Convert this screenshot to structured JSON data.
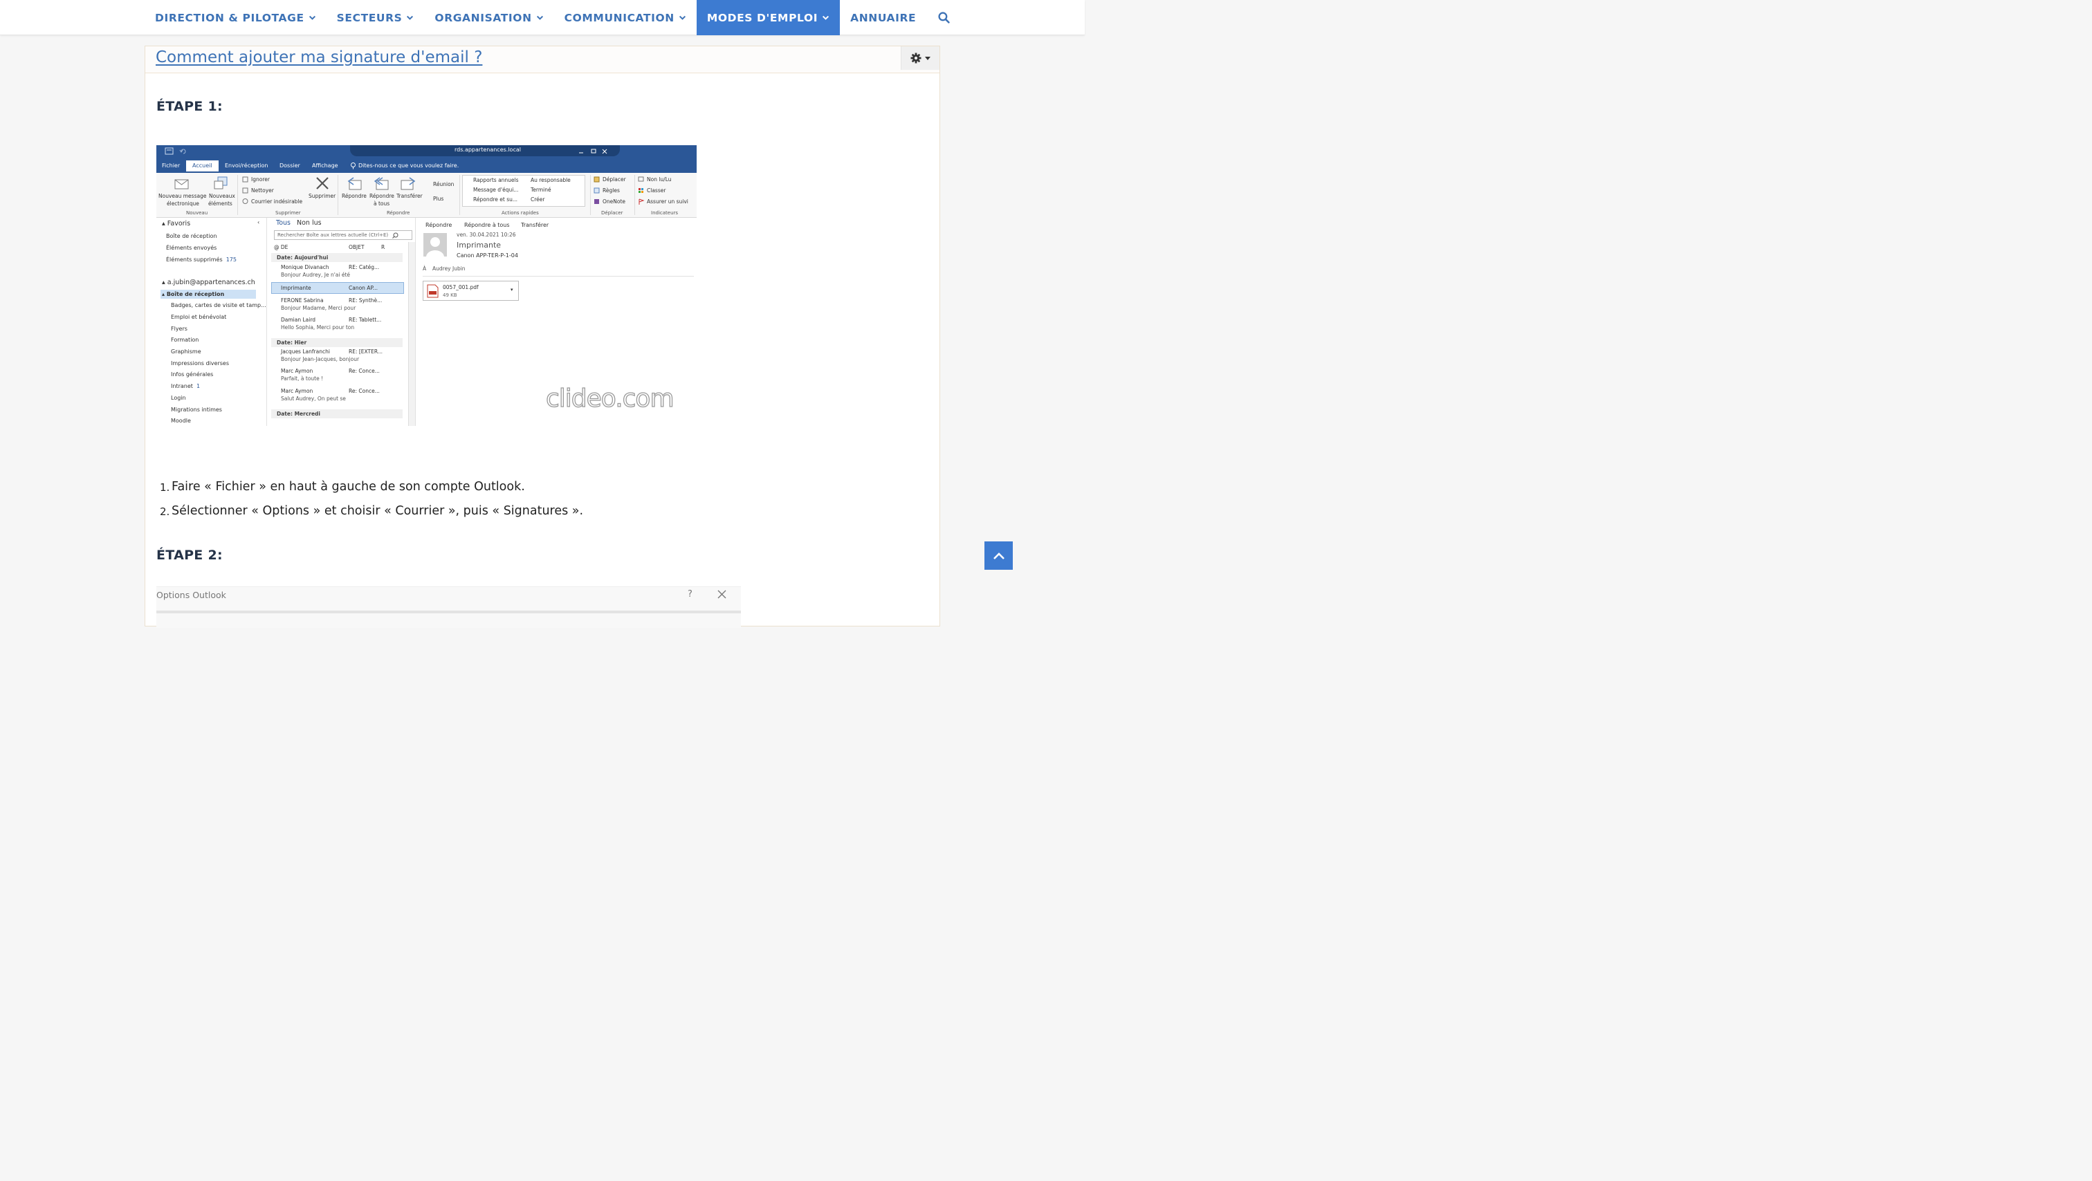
{
  "nav": {
    "items": [
      {
        "label": "DIRECTION & PILOTAGE",
        "dropdown": true,
        "active": false
      },
      {
        "label": "SECTEURS",
        "dropdown": true,
        "active": false
      },
      {
        "label": "ORGANISATION",
        "dropdown": true,
        "active": false
      },
      {
        "label": "COMMUNICATION",
        "dropdown": true,
        "active": false
      },
      {
        "label": "MODES D'EMPLOI",
        "dropdown": true,
        "active": true
      },
      {
        "label": "ANNUAIRE",
        "dropdown": false,
        "active": false
      }
    ],
    "search_icon": "search-icon"
  },
  "article": {
    "title": "Comment ajouter ma signature d'email ?",
    "tools_icon": "gear-icon",
    "step1": "ÉTAPE 1:",
    "step2": "ÉTAPE 2:",
    "steps": [
      {
        "num": "1.",
        "text": "Faire « Fichier » en haut à gauche de son compte Outlook."
      },
      {
        "num": "2.",
        "text": "Sélectionner « Options » et choisir « Courrier », puis « Signatures »."
      }
    ]
  },
  "outlook": {
    "window_title": "rds.appartenances.local",
    "tabs": [
      "Fichier",
      "Accueil",
      "Envoi/réception",
      "Dossier",
      "Affichage"
    ],
    "tell_me": "Dites-nous ce que vous voulez faire.",
    "ribbon": {
      "new_mail": [
        "Nouveau message",
        "électronique"
      ],
      "new_items": [
        "Nouveaux",
        "éléments"
      ],
      "ignore": "Ignorer",
      "clean": "Nettoyer",
      "junk": "Courrier indésirable",
      "delete": "Supprimer",
      "reply": "Répondre",
      "reply_all": [
        "Répondre",
        "à tous"
      ],
      "forward": "Transférer",
      "meeting": "Réunion",
      "more": "Plus",
      "quick_steps": [
        "Rapports annuels",
        "Message d'équi...",
        "Répondre et su...",
        "Au responsable",
        "Terminé",
        "Créer"
      ],
      "move": "Déplacer",
      "rules": "Règles",
      "onenote": "OneNote",
      "unread": "Non lu/Lu",
      "categorize": "Classer",
      "follow_up": "Assurer un suivi",
      "groups": [
        "Nouveau",
        "Supprimer",
        "Répondre",
        "Actions rapides",
        "Déplacer",
        "Indicateurs"
      ]
    },
    "folders": {
      "favorites": "Favoris",
      "fav_items": [
        "Boîte de réception",
        "Éléments envoyés",
        "Éléments supprimés"
      ],
      "deleted_count": "175",
      "account": "a.jubin@appartenances.ch",
      "inbox": "Boîte de réception",
      "subfolders": [
        "Badges, cartes de visite et tamp...",
        "Emploi et bénévolat",
        "Flyers",
        "Formation",
        "Graphisme",
        "Impressions diverses",
        "Infos générales",
        "Intranet",
        "Login",
        "Migrations intimes",
        "Moodle"
      ],
      "intranet_count": "1"
    },
    "list": {
      "filter_all": "Tous",
      "filter_unread": "Non lus",
      "search_placeholder": "Rechercher Boîte aux lettres actuelle (Ctrl+E)",
      "col_from": "DE",
      "col_subject": "OBJET",
      "col_r": "R",
      "date_today": "Date: Aujourd'hui",
      "date_yesterday": "Date: Hier",
      "date_wednesday": "Date: Mercredi",
      "messages": [
        {
          "from": "Monique Divanach",
          "subject": "RE: Catég...",
          "preview": "Bonjour Audrey,  Je n'ai été"
        },
        {
          "from": "Imprimante",
          "subject": "Canon AP...",
          "preview": ""
        },
        {
          "from": "FERONE Sabrina",
          "subject": "RE: Synthè...",
          "preview": "Bonjour Madame,  Merci pour"
        },
        {
          "from": "Damian Laird",
          "subject": "RE: Tablett...",
          "preview": "Hello Sophia,  Merci pour ton"
        },
        {
          "from": "Jacques Lanfranchi",
          "subject": "RE: [EXTER...",
          "preview": "Bonjour Jean-Jacques, bonjour"
        },
        {
          "from": "Marc Aymon",
          "subject": "Re: Conce...",
          "preview": "Parfait, à toute !"
        },
        {
          "from": "Marc Aymon",
          "subject": "Re: Conce...",
          "preview": "Salut Audrey,  On peut se"
        }
      ]
    },
    "reading": {
      "reply": "Répondre",
      "reply_all": "Répondre à tous",
      "forward": "Transférer",
      "date": "ven. 30.04.2021 10:26",
      "sender": "Imprimante",
      "subject": "Canon APP-TER-P-1-04",
      "to_label": "À",
      "to": "Audrey Jubin",
      "attachment_name": "0057_001.pdf",
      "attachment_size": "49 KB"
    },
    "watermark": "clideo.com"
  },
  "options_window": {
    "title": "Options Outlook",
    "help": "?"
  },
  "colors": {
    "nav_text": "#3e73b6",
    "nav_active_bg": "#3d7bd1",
    "heading": "#253348",
    "outlook_blue": "#2b5797"
  }
}
